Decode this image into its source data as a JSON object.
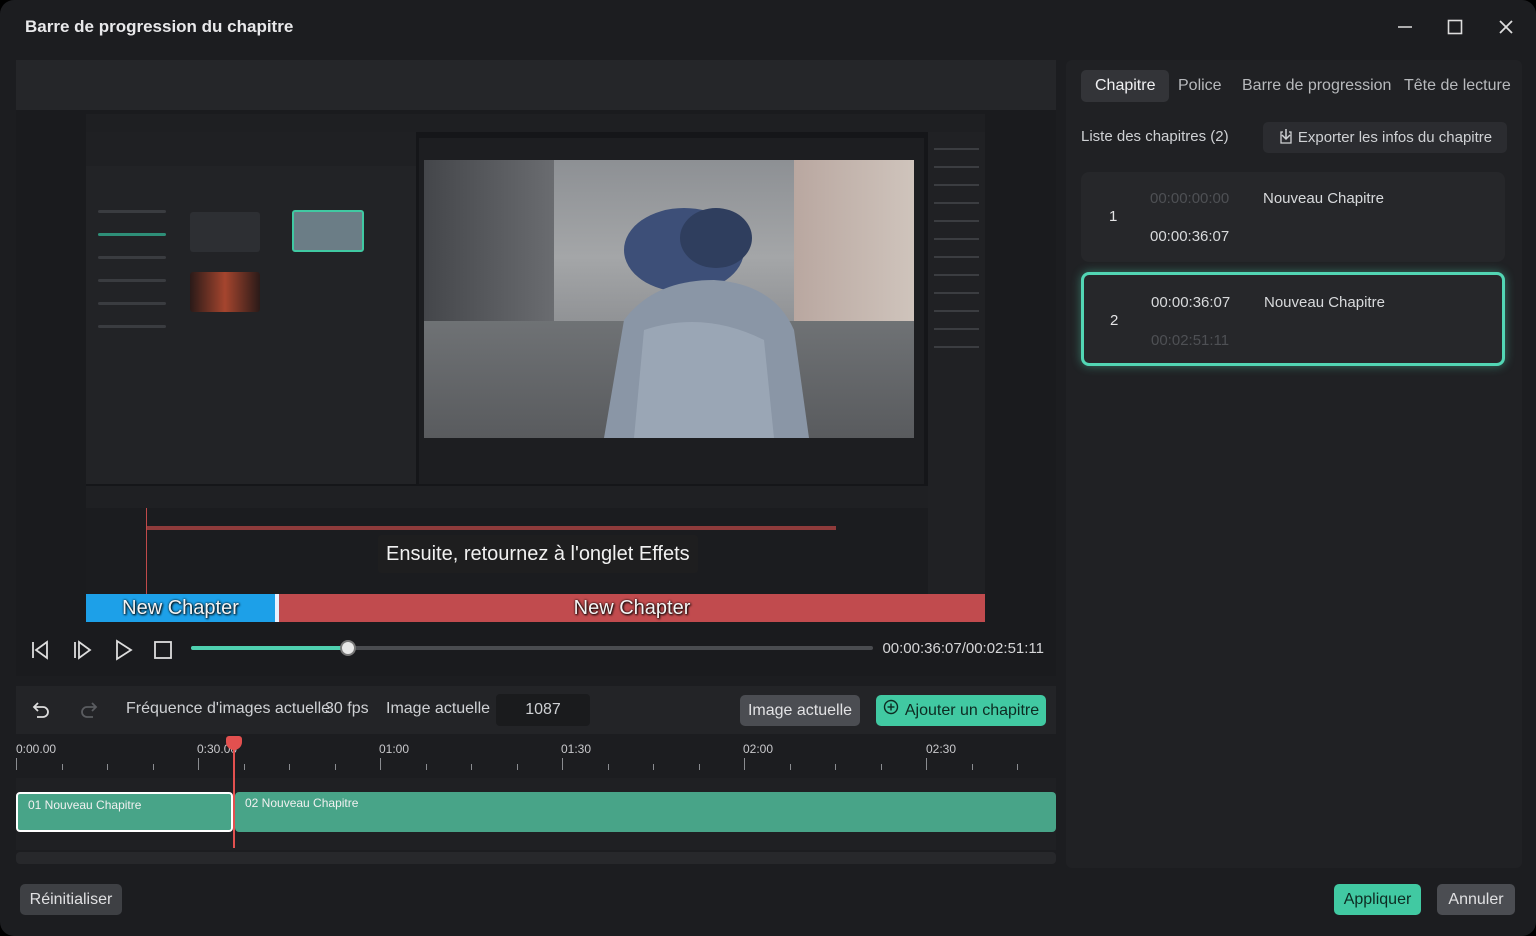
{
  "window": {
    "title": "Barre de progression du chapitre"
  },
  "preview": {
    "caption": "Ensuite, retournez à l'onglet Effets",
    "chapter_bar": [
      "New Chapter",
      "New Chapter"
    ],
    "colors": {
      "chapter1": "#1da0e8",
      "chapter2": "#c14b4e",
      "accent": "#41c9a2"
    }
  },
  "transport": {
    "timecode": "00:00:36:07/00:02:51:11",
    "progress": 0.23
  },
  "toolbar": {
    "framerate_label": "Fréquence d'images actuelle",
    "framerate_value": "30 fps",
    "frame_label": "Image actuelle",
    "frame_value": "1087",
    "current_frame_button": "Image actuelle",
    "add_chapter_button": "Ajouter un chapitre"
  },
  "ruler": {
    "labels": [
      "0:00.00",
      "0:30.00",
      "01:00",
      "01:30",
      "02:00",
      "02:30"
    ]
  },
  "timeline": {
    "clips": [
      "01 Nouveau Chapitre",
      "02 Nouveau Chapitre"
    ]
  },
  "panel": {
    "tabs": [
      "Chapitre",
      "Police",
      "Barre de progression",
      "Tête de lecture"
    ],
    "list_title": "Liste des chapitres (2)",
    "export_button": "Exporter les infos du chapitre",
    "chapters": [
      {
        "num": "1",
        "start": "00:00:00:00",
        "end": "00:00:36:07",
        "name": "Nouveau Chapitre"
      },
      {
        "num": "2",
        "start": "00:00:36:07",
        "end": "00:02:51:11",
        "name": "Nouveau Chapitre"
      }
    ]
  },
  "footer": {
    "reset": "Réinitialiser",
    "apply": "Appliquer",
    "cancel": "Annuler"
  }
}
